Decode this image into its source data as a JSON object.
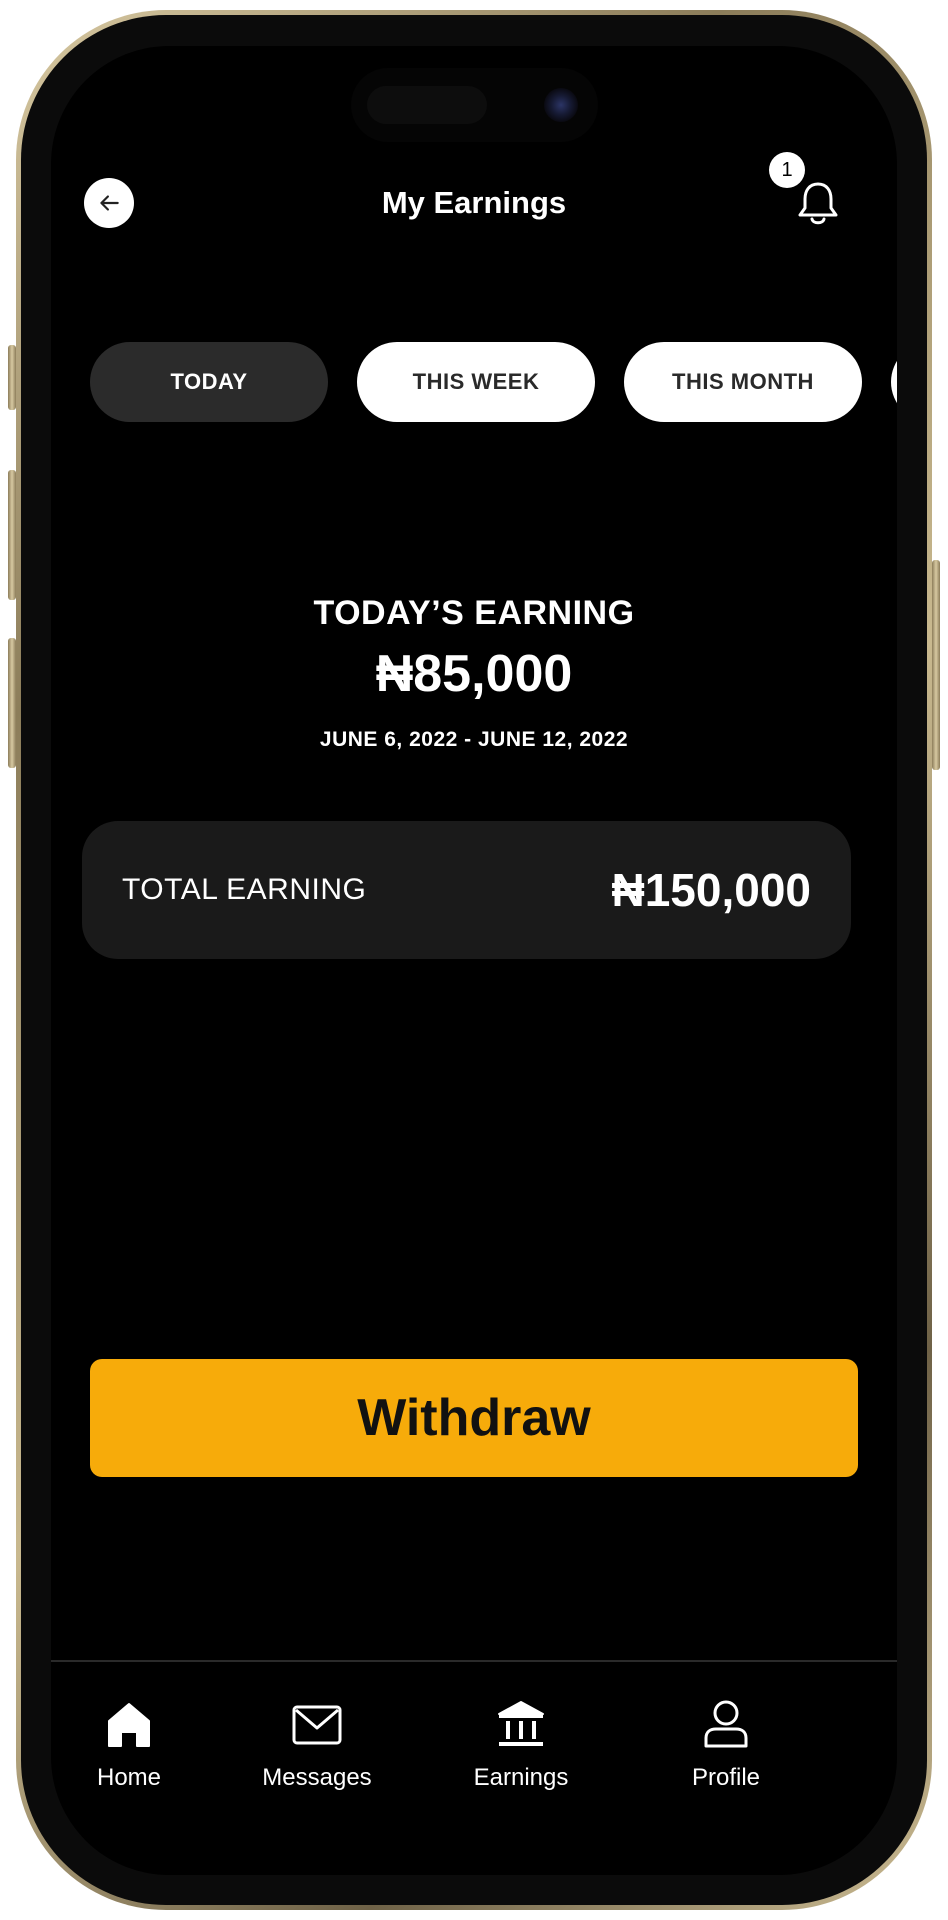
{
  "header": {
    "title": "My Earnings",
    "notification_count": "1"
  },
  "tabs": [
    {
      "label": "TODAY",
      "active": true
    },
    {
      "label": "THIS WEEK",
      "active": false
    },
    {
      "label": "THIS MONTH",
      "active": false
    }
  ],
  "summary": {
    "label": "TODAY’S EARNING",
    "amount": "₦85,000",
    "date_range": "JUNE 6, 2022 - JUNE 12, 2022"
  },
  "total_card": {
    "label": "TOTAL EARNING",
    "value": "₦150,000"
  },
  "withdraw": {
    "label": "Withdraw"
  },
  "bottom_nav": {
    "items": [
      {
        "label": "Home",
        "icon": "home-icon"
      },
      {
        "label": "Messages",
        "icon": "envelope-icon"
      },
      {
        "label": "Earnings",
        "icon": "bank-icon"
      },
      {
        "label": "Profile",
        "icon": "user-icon"
      }
    ]
  },
  "colors": {
    "accent": "#f7ab0a",
    "background": "#000000",
    "card": "#1a1a1a",
    "active_tab": "#2b2b2b"
  }
}
